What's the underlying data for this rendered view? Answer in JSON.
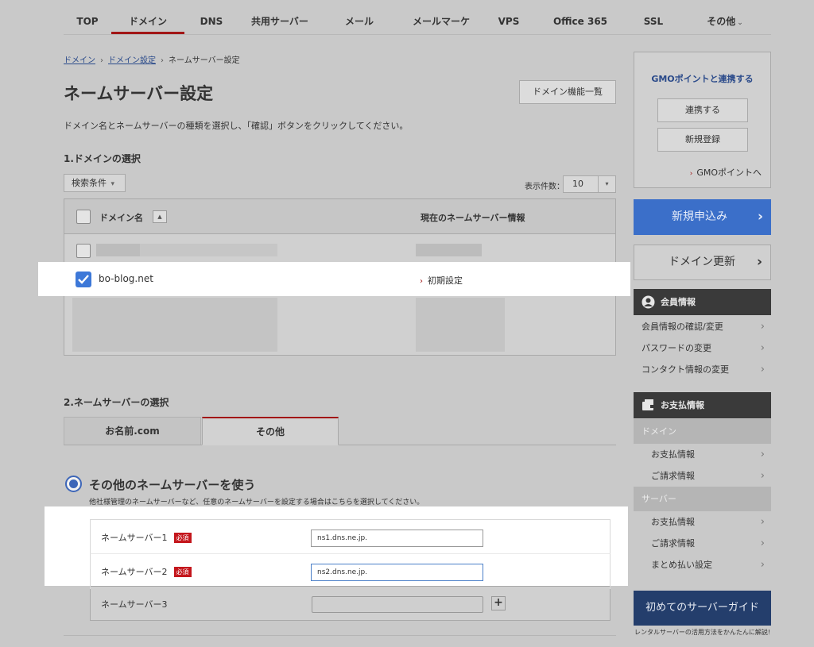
{
  "nav": {
    "items": [
      {
        "label": "TOP"
      },
      {
        "label": "ドメイン"
      },
      {
        "label": "DNS"
      },
      {
        "label": "共用サーバー"
      },
      {
        "label": "メール"
      },
      {
        "label": "メールマーケ"
      },
      {
        "label": "VPS"
      },
      {
        "label": "Office 365"
      },
      {
        "label": "SSL"
      },
      {
        "label": "その他"
      }
    ],
    "active_index": 1
  },
  "breadcrumb": {
    "items": [
      "ドメイン",
      "ドメイン設定",
      "ネームサーバー設定"
    ],
    "separator": "›"
  },
  "page": {
    "title": "ネームサーバー設定",
    "func_list_button": "ドメイン機能一覧",
    "lead": "ドメイン名とネームサーバーの種類を選択し、「確認」ボタンをクリックしてください。"
  },
  "section1": {
    "title": "1.ドメインの選択",
    "search_condition": "検索条件",
    "per_page_label": "表示件数：",
    "per_page_value": "10",
    "table": {
      "col_domain": "ドメイン名",
      "col_ns": "現在のネームサーバー情報",
      "rows": [
        {
          "domain": "bo-blog.net",
          "ns_info": "初期設定",
          "checked": true
        }
      ]
    }
  },
  "section2": {
    "title": "2.ネームサーバーの選択",
    "tabs": [
      "お名前.com",
      "その他"
    ],
    "active_tab": 1,
    "radio_label": "その他のネームサーバーを使う",
    "radio_desc": "他社様管理のネームサーバーなど、任意のネームサーバーを設定する場合はこちらを選択してください。",
    "required_badge": "必須",
    "nameservers": [
      {
        "label": "ネームサーバー1",
        "value": "ns1.dns.ne.jp.",
        "required": true
      },
      {
        "label": "ネームサーバー2",
        "value": "ns2.dns.ne.jp.",
        "required": true
      },
      {
        "label": "ネームサーバー3",
        "value": "",
        "required": false
      }
    ],
    "add_button": "+"
  },
  "sidebar": {
    "gmo": {
      "title": "GMOポイントと連携する",
      "link_button": "連携する",
      "register_button": "新規登録",
      "point_link": "GMOポイントへ"
    },
    "apply_button": "新規申込み",
    "renew_button": "ドメイン更新",
    "member": {
      "title": "会員情報",
      "items": [
        "会員情報の確認/変更",
        "パスワードの変更",
        "コンタクト情報の変更"
      ]
    },
    "payment": {
      "title": "お支払情報",
      "groups": [
        {
          "category": "ドメイン",
          "items": [
            "お支払情報",
            "ご請求情報"
          ]
        },
        {
          "category": "サーバー",
          "items": [
            "お支払情報",
            "ご請求情報",
            "まとめ払い設定"
          ]
        }
      ]
    },
    "guide": {
      "title": "初めてのサーバーガイド",
      "caption": "レンタルサーバーの活用方法をかんたんに解説!"
    }
  },
  "colors": {
    "accent_red": "#a21616",
    "brand_blue": "#3b6fc9",
    "checkbox_blue": "#3d78d8",
    "required_red": "#c4161c",
    "dark_header": "#3a3a3a",
    "guide_navy": "#243e6c"
  },
  "icons": {
    "member_icon": "user-circle-icon",
    "payment_icon": "wallet-icon",
    "check_icon": "check-icon",
    "chevron_icon": "chevron-right-icon"
  }
}
